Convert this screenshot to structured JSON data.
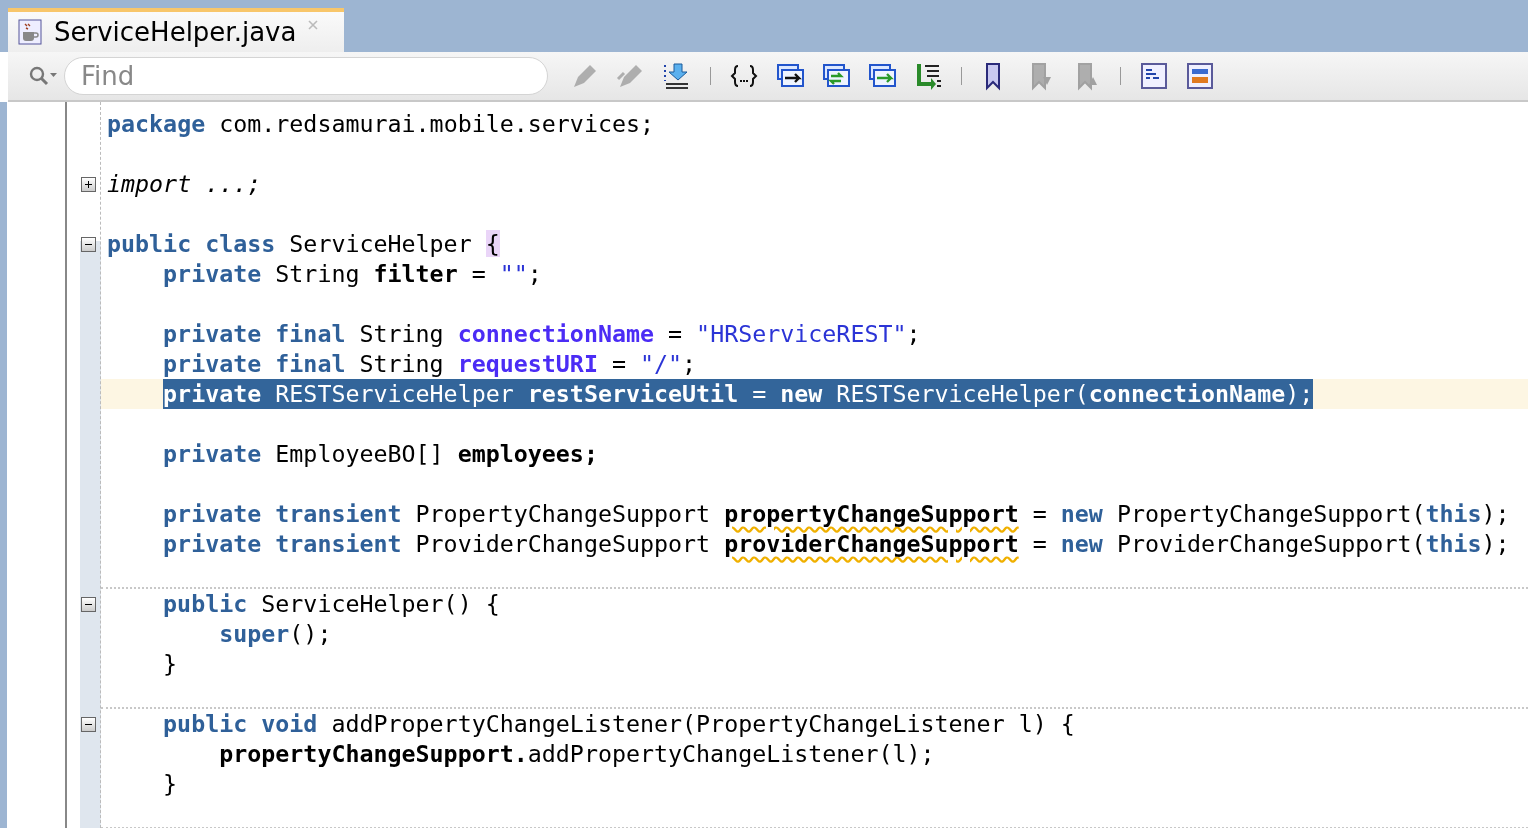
{
  "tab": {
    "title": "ServiceHelper.java",
    "selected": true
  },
  "search": {
    "placeholder": "Find"
  },
  "toolbar": [
    {
      "kind": "button",
      "disabled": true
    },
    {
      "kind": "button",
      "disabled": true
    },
    {
      "kind": "button",
      "disabled": false
    },
    {
      "kind": "separator"
    },
    {
      "kind": "button",
      "disabled": false
    },
    {
      "kind": "button",
      "disabled": false
    },
    {
      "kind": "button",
      "disabled": false
    },
    {
      "kind": "button",
      "disabled": false
    },
    {
      "kind": "button",
      "disabled": false
    },
    {
      "kind": "separator"
    },
    {
      "kind": "button",
      "disabled": false
    },
    {
      "kind": "button",
      "disabled": true
    },
    {
      "kind": "button",
      "disabled": true
    },
    {
      "kind": "separator"
    },
    {
      "kind": "button",
      "disabled": false
    },
    {
      "kind": "button",
      "disabled": false
    }
  ],
  "lines": [
    {
      "kind": "code",
      "tokens": [
        {
          "text": "package",
          "kind": "keyword"
        },
        {
          "text": " com.redsamurai.mobile.services;",
          "kind": "plain"
        }
      ]
    },
    {
      "kind": "blank"
    },
    {
      "kind": "code",
      "fold": {
        "expanded": false
      },
      "tokens": [
        {
          "text": "import ...;",
          "kind": "italic"
        }
      ]
    },
    {
      "kind": "blank"
    },
    {
      "kind": "code",
      "fold": {
        "expanded": true
      },
      "tokens": [
        {
          "text": "public class",
          "kind": "keyword"
        },
        {
          "text": " ServiceHelper ",
          "kind": "plain"
        },
        {
          "text": "{",
          "kind": "match"
        }
      ],
      "children": [
        {
          "kind": "code",
          "tokens": [
            {
              "text": "private",
              "kind": "keyword"
            },
            {
              "text": " String ",
              "kind": "plain"
            },
            {
              "text": "filter",
              "kind": "field"
            },
            {
              "text": " = ",
              "kind": "plain"
            },
            {
              "text": "\"\"",
              "kind": "string"
            },
            {
              "text": ";",
              "kind": "plain"
            }
          ]
        },
        {
          "kind": "blank"
        },
        {
          "kind": "code",
          "tokens": [
            {
              "text": "private final",
              "kind": "keyword"
            },
            {
              "text": " String ",
              "kind": "plain"
            },
            {
              "text": "connectionName",
              "kind": "constant"
            },
            {
              "text": " = ",
              "kind": "plain"
            },
            {
              "text": "\"HRServiceREST\"",
              "kind": "string"
            },
            {
              "text": ";",
              "kind": "plain"
            }
          ]
        },
        {
          "kind": "code",
          "tokens": [
            {
              "text": "private final",
              "kind": "keyword"
            },
            {
              "text": " String ",
              "kind": "plain"
            },
            {
              "text": "requestURI",
              "kind": "constant"
            },
            {
              "text": " = ",
              "kind": "plain"
            },
            {
              "text": "\"/\"",
              "kind": "string"
            },
            {
              "text": ";",
              "kind": "plain"
            }
          ]
        },
        {
          "kind": "code",
          "current": true,
          "selected": true,
          "tokens": [
            {
              "text": "private",
              "kind": "keyword"
            },
            {
              "text": " RESTServiceHelper ",
              "kind": "plain"
            },
            {
              "text": "restServiceUtil",
              "kind": "field"
            },
            {
              "text": " = ",
              "kind": "plain"
            },
            {
              "text": "new",
              "kind": "keyword"
            },
            {
              "text": " RESTServiceHelper(",
              "kind": "plain"
            },
            {
              "text": "connectionName",
              "kind": "field"
            },
            {
              "text": ");",
              "kind": "plain"
            }
          ]
        },
        {
          "kind": "blank"
        },
        {
          "kind": "code",
          "tokens": [
            {
              "text": "private",
              "kind": "keyword"
            },
            {
              "text": " EmployeeBO[] ",
              "kind": "plain"
            },
            {
              "text": "employees;",
              "kind": "field"
            }
          ]
        },
        {
          "kind": "blank"
        },
        {
          "kind": "code",
          "tokens": [
            {
              "text": "private transient",
              "kind": "keyword"
            },
            {
              "text": " PropertyChangeSupport ",
              "kind": "plain"
            },
            {
              "text": "propertyChangeSupport",
              "kind": "field",
              "warning": true
            },
            {
              "text": " = ",
              "kind": "plain"
            },
            {
              "text": "new",
              "kind": "keyword"
            },
            {
              "text": " PropertyChangeSupport(",
              "kind": "plain"
            },
            {
              "text": "this",
              "kind": "keyword"
            },
            {
              "text": ");",
              "kind": "plain"
            }
          ]
        },
        {
          "kind": "code",
          "tokens": [
            {
              "text": "private transient",
              "kind": "keyword"
            },
            {
              "text": " ProviderChangeSupport ",
              "kind": "plain"
            },
            {
              "text": "providerChangeSupport",
              "kind": "field",
              "warning": true
            },
            {
              "text": " = ",
              "kind": "plain"
            },
            {
              "text": "new",
              "kind": "keyword"
            },
            {
              "text": " ProviderChangeSupport(",
              "kind": "plain"
            },
            {
              "text": "this",
              "kind": "keyword"
            },
            {
              "text": ");",
              "kind": "plain"
            }
          ]
        },
        {
          "kind": "separator"
        },
        {
          "kind": "code",
          "fold": {
            "expanded": true
          },
          "tokens": [
            {
              "text": "public",
              "kind": "keyword"
            },
            {
              "text": " ServiceHelper() {",
              "kind": "plain"
            }
          ],
          "children": [
            {
              "kind": "code",
              "tokens": [
                {
                  "text": "super",
                  "kind": "keyword"
                },
                {
                  "text": "();",
                  "kind": "plain"
                }
              ]
            }
          ]
        },
        {
          "kind": "code",
          "tokens": [
            {
              "text": "}",
              "kind": "plain"
            }
          ]
        },
        {
          "kind": "separator"
        },
        {
          "kind": "code",
          "fold": {
            "expanded": true
          },
          "tokens": [
            {
              "text": "public void",
              "kind": "keyword"
            },
            {
              "text": " addPropertyChangeListener(PropertyChangeListener l) {",
              "kind": "plain"
            }
          ],
          "children": [
            {
              "kind": "code",
              "tokens": [
                {
                  "text": "propertyChangeSupport.",
                  "kind": "field"
                },
                {
                  "text": "addPropertyChangeListener(l);",
                  "kind": "plain"
                }
              ]
            }
          ]
        },
        {
          "kind": "code",
          "tokens": [
            {
              "text": "}",
              "kind": "plain"
            }
          ]
        },
        {
          "kind": "separator"
        }
      ]
    }
  ]
}
